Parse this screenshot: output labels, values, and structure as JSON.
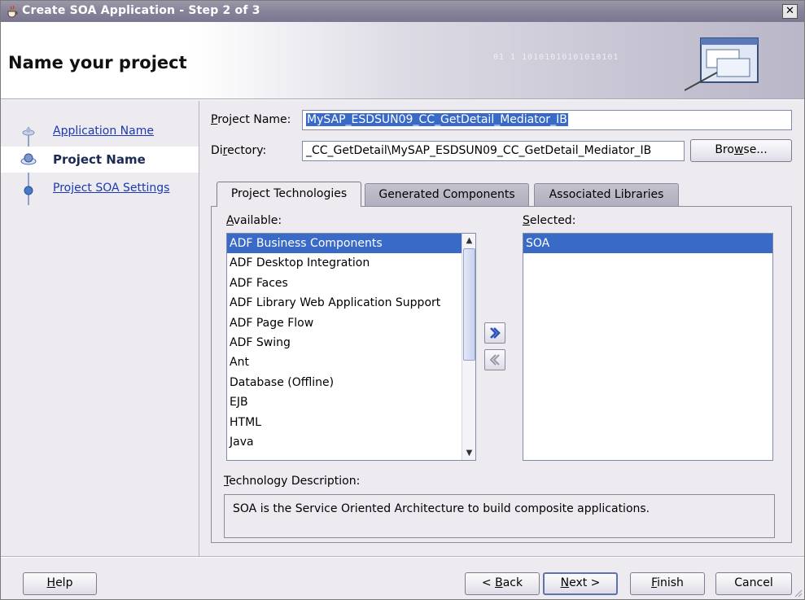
{
  "window": {
    "title": "Create SOA Application - Step 2 of 3",
    "close_glyph": "✕"
  },
  "header": {
    "page_title": "Name your project",
    "binary_deco": "01 1 10101010101010101"
  },
  "train": {
    "steps": [
      {
        "label": "Application Name",
        "state": "visited"
      },
      {
        "label": "Project Name",
        "state": "current"
      },
      {
        "label": "Project SOA Settings",
        "state": "next"
      }
    ]
  },
  "form": {
    "project_name_label_pre": "",
    "project_name_label_mnemonic": "P",
    "project_name_label_post": "roject Name:",
    "project_name_value": "MySAP_ESDSUN09_CC_GetDetail_Mediator_IB",
    "directory_label_pre": "Di",
    "directory_label_mnemonic": "r",
    "directory_label_post": "ectory:",
    "directory_value": "_CC_GetDetail\\MySAP_ESDSUN09_CC_GetDetail_Mediator_IB",
    "browse_pre": "Bro",
    "browse_mnemonic": "w",
    "browse_post": "se..."
  },
  "tabs": [
    {
      "label": "Project Technologies",
      "active": true
    },
    {
      "label": "Generated Components",
      "active": false
    },
    {
      "label": "Associated Libraries",
      "active": false
    }
  ],
  "technologies": {
    "available_label_mnemonic": "A",
    "available_label_rest": "vailable:",
    "selected_label_mnemonic": "S",
    "selected_label_rest": "elected:",
    "available": [
      "ADF Business Components",
      "ADF Desktop Integration",
      "ADF Faces",
      "ADF Library Web Application Support",
      "ADF Page Flow",
      "ADF Swing",
      "Ant",
      "Database (Offline)",
      "EJB",
      "HTML",
      "Java"
    ],
    "available_selected_index": 0,
    "selected": [
      "SOA"
    ],
    "add_glyph": "»",
    "remove_glyph": "«",
    "description_label_mnemonic": "T",
    "description_label_rest": "echnology Description:",
    "description": "SOA is the Service Oriented Architecture to build composite applications."
  },
  "footer": {
    "help_mnemonic": "H",
    "help_rest": "elp",
    "back_pre": "< ",
    "back_mnemonic": "B",
    "back_rest": "ack",
    "next_mnemonic": "N",
    "next_rest": "ext >",
    "finish_mnemonic": "F",
    "finish_rest": "inish",
    "cancel": "Cancel"
  }
}
